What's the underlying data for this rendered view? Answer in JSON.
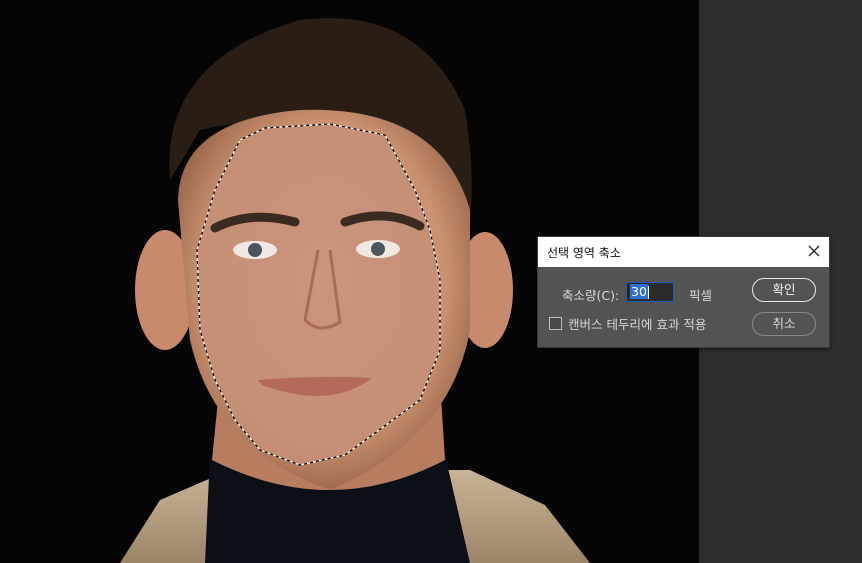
{
  "dialog": {
    "title": "선택 영역 축소",
    "amount_label": "축소량(C):",
    "amount_value": "30",
    "unit_label": "픽셀",
    "apply_at_canvas_label": "캔버스 테두리에 효과 적용",
    "apply_at_canvas_checked": false,
    "ok_label": "확인",
    "cancel_label": "취소"
  },
  "icons": {
    "close": "close-icon"
  },
  "colors": {
    "canvas_bg": "#050505",
    "panel_bg": "#2d2d2d",
    "dialog_bg": "#535353",
    "selection_fill": "#c58f78"
  }
}
